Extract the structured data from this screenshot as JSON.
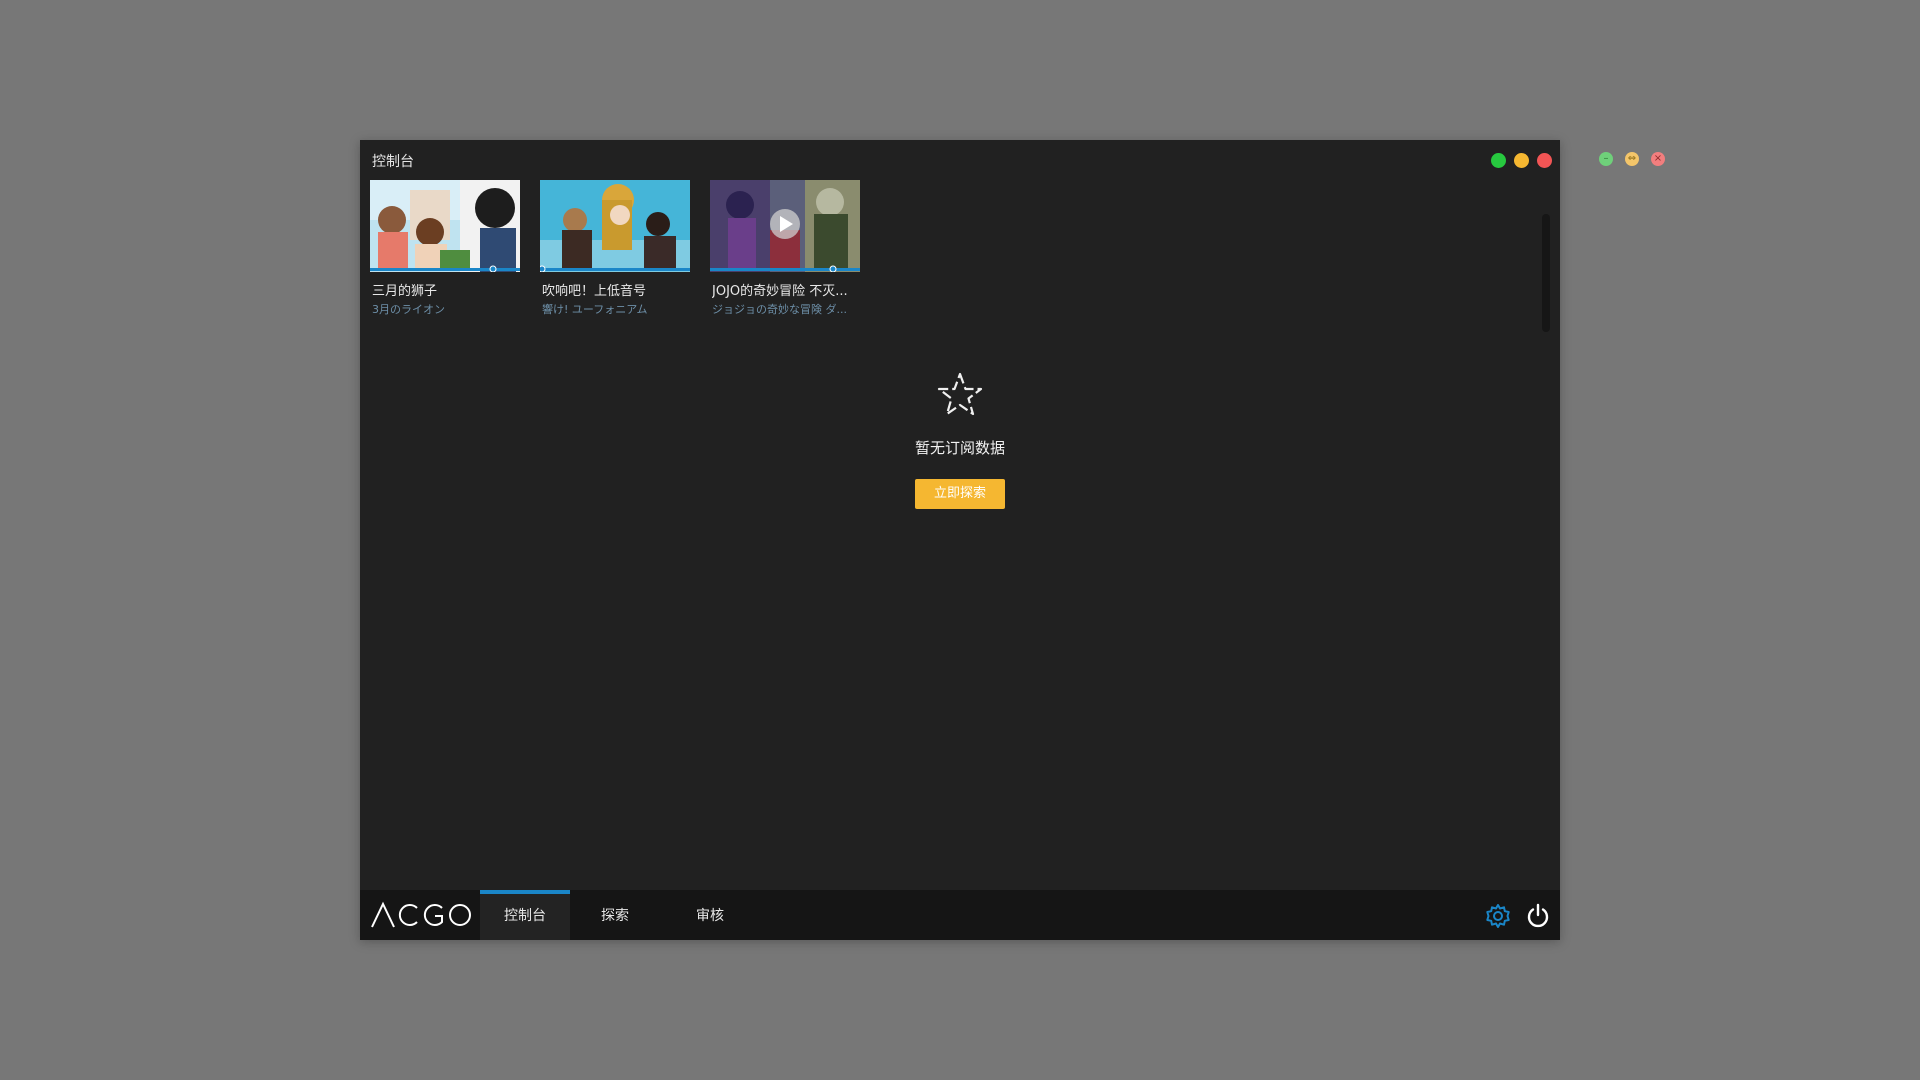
{
  "window": {
    "title": "控制台"
  },
  "cards": [
    {
      "title": "三月的狮子",
      "subtitle": "3月のライオン",
      "thumbnail_icon": "anime-thumbnail-image"
    },
    {
      "title": "吹响吧！上低音号",
      "subtitle": "響け! ユーフォニアム",
      "thumbnail_icon": "anime-thumbnail-image"
    },
    {
      "title": "JOJO的奇妙冒险 不灭...",
      "subtitle": "ジョジョの奇妙な冒険 ダ...",
      "thumbnail_icon": "anime-thumbnail-image",
      "overlay_icon": "play-icon"
    }
  ],
  "empty_state": {
    "icon": "star-outline-icon",
    "message": "暂无订阅数据",
    "button_label": "立即探索"
  },
  "bottom_nav": {
    "logo_text": "ACGO",
    "tabs": [
      {
        "label": "控制台",
        "active": true
      },
      {
        "label": "探索",
        "active": false
      },
      {
        "label": "审核",
        "active": false
      }
    ],
    "right_icons": [
      "settings-gear-icon",
      "power-icon"
    ]
  },
  "colors": {
    "accent_blue": "#1a86c8",
    "button_yellow": "#f5b731",
    "traffic_green": "#27c93f",
    "traffic_yellow": "#f5b731",
    "traffic_red": "#f25555"
  }
}
